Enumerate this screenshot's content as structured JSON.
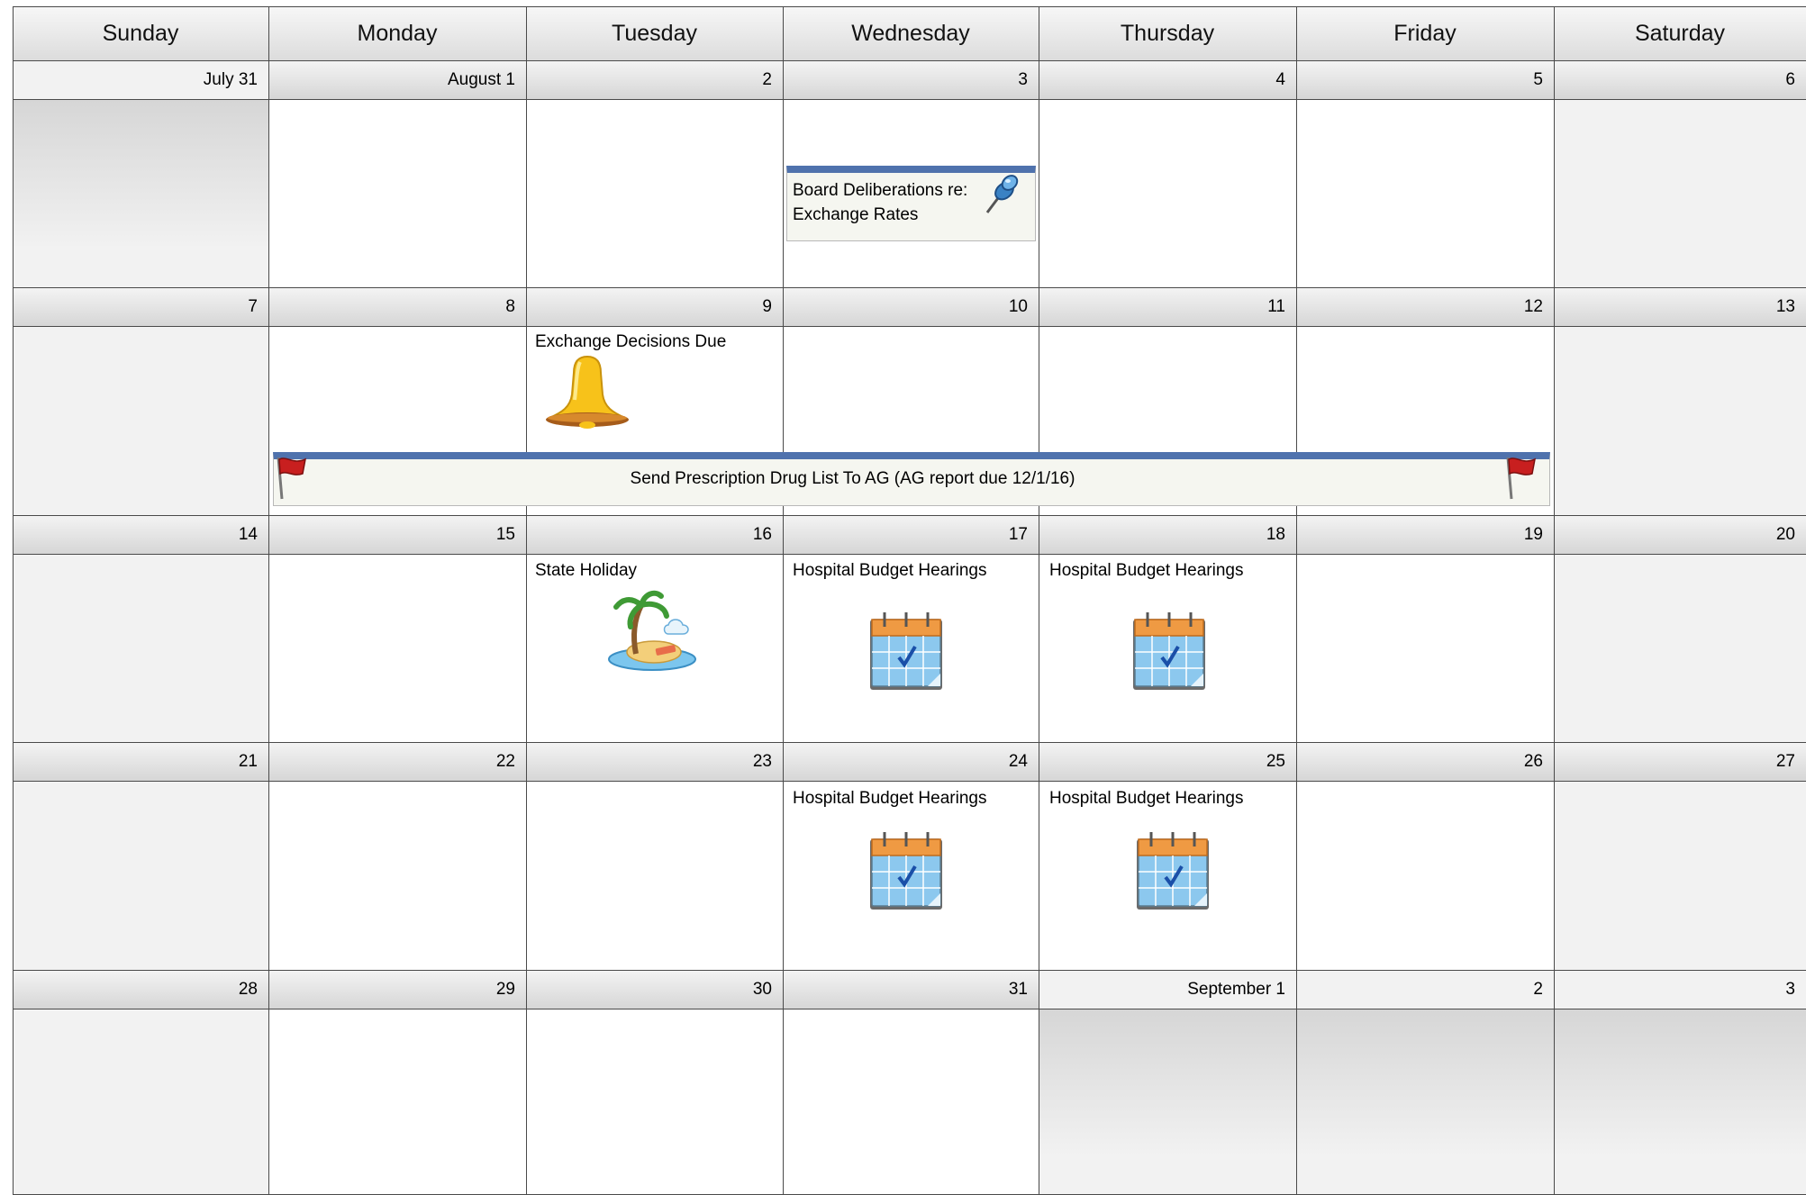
{
  "calendar": {
    "weekdays": [
      "Sunday",
      "Monday",
      "Tuesday",
      "Wednesday",
      "Thursday",
      "Friday",
      "Saturday"
    ],
    "weeks": [
      [
        "July 31",
        "August 1",
        "2",
        "3",
        "4",
        "5",
        "6"
      ],
      [
        "7",
        "8",
        "9",
        "10",
        "11",
        "12",
        "13"
      ],
      [
        "14",
        "15",
        "16",
        "17",
        "18",
        "19",
        "20"
      ],
      [
        "21",
        "22",
        "23",
        "24",
        "25",
        "26",
        "27"
      ],
      [
        "28",
        "29",
        "30",
        "31",
        "September 1",
        "2",
        "3"
      ]
    ],
    "events": {
      "board_deliberations": {
        "title": "Board Deliberations re: Exchange Rates",
        "line1": "Board Deliberations re:",
        "line2": "Exchange Rates",
        "icon": "pushpin-icon"
      },
      "exchange_decisions": {
        "title": "Exchange Decisions Due",
        "icon": "bell-icon"
      },
      "prescription_drug_list": {
        "title": "Send Prescription Drug List To AG (AG report due 12/1/16)",
        "icon": "red-flag-icon"
      },
      "state_holiday": {
        "title": "State Holiday",
        "icon": "palm-island-icon"
      },
      "hospital_budget_17": {
        "title": "Hospital Budget Hearings",
        "icon": "calendar-check-icon"
      },
      "hospital_budget_18": {
        "title": "Hospital Budget Hearings",
        "icon": "calendar-check-icon"
      },
      "hospital_budget_24": {
        "title": "Hospital Budget Hearings",
        "icon": "calendar-check-icon"
      },
      "hospital_budget_25": {
        "title": "Hospital Budget Hearings",
        "icon": "calendar-check-icon"
      }
    },
    "colors": {
      "event_bar": "#4f72ad",
      "grid_line": "#4a4a4a",
      "weekend_fill": "#f2f2f2"
    }
  }
}
